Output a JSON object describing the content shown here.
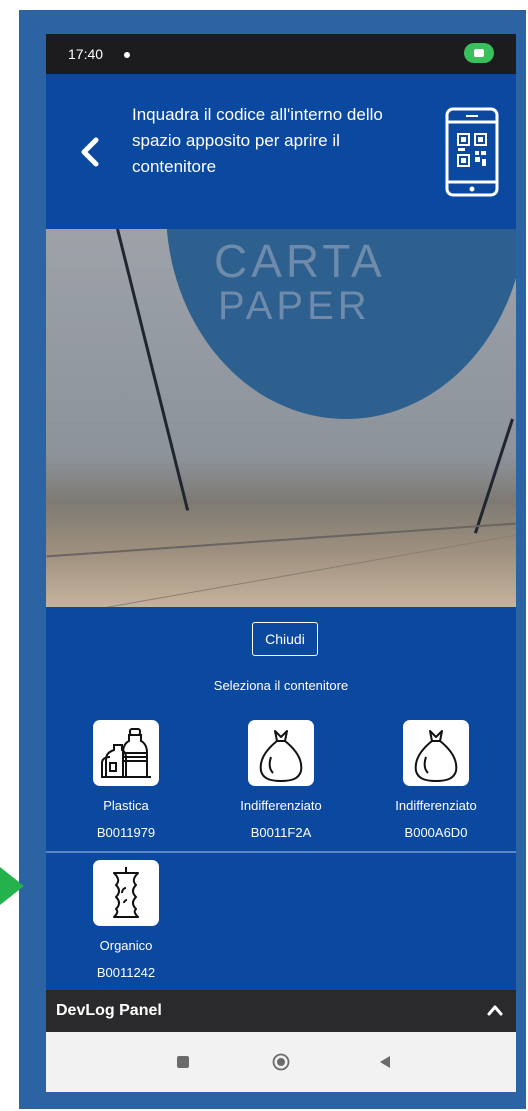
{
  "status_bar": {
    "time": "17:40"
  },
  "header": {
    "instruction": "Inquadra il codice all'interno dello spazio apposito per aprire il contenitore",
    "back_icon": "chevron-left-icon",
    "qr_icon": "phone-qr-icon"
  },
  "camera": {
    "sign_line1": "CARTA",
    "sign_line2": "PAPER"
  },
  "close_button": "Chiudi",
  "select_label": "Seleziona il contenitore",
  "containers": [
    {
      "name": "Plastica",
      "code": "B0011979",
      "icon": "plastic-bottles-icon"
    },
    {
      "name": "Indifferenziato",
      "code": "B0011F2A",
      "icon": "trash-bag-icon"
    },
    {
      "name": "Indifferenziato",
      "code": "B000A6D0",
      "icon": "trash-bag-icon"
    },
    {
      "name": "Organico",
      "code": "B0011242",
      "icon": "apple-core-icon"
    }
  ],
  "devlog": {
    "title": "DevLog Panel",
    "toggle_icon": "chevron-up-icon"
  },
  "colors": {
    "primary": "#0b49a1",
    "frame": "#2c63a3",
    "accent_marker": "#23b24b"
  }
}
